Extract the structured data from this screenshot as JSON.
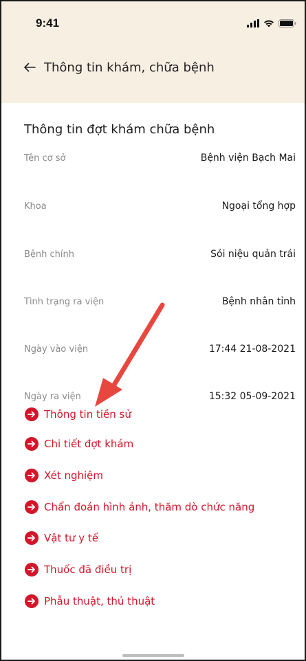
{
  "status_bar": {
    "time": "9:41"
  },
  "nav": {
    "title": "Thông tin khám, chữa bệnh"
  },
  "section": {
    "title": "Thông tin đợt khám chữa bệnh"
  },
  "info_rows": [
    {
      "label": "Tên cơ sở",
      "value": "Bệnh viện Bạch Mai"
    },
    {
      "label": "Khoa",
      "value": "Ngoại tổng hợp"
    },
    {
      "label": "Bệnh chính",
      "value": "Sỏi niệu quản trái"
    },
    {
      "label": "Tình trạng ra viện",
      "value": "Bệnh nhân tỉnh"
    },
    {
      "label": "Ngày vào viện",
      "value": "17:44 21-08-2021"
    },
    {
      "label": "Ngày ra viện",
      "value": "15:32 05-09-2021"
    }
  ],
  "links": [
    {
      "label": "Thông tin tiền sử"
    },
    {
      "label": "Chi tiết đợt khám"
    },
    {
      "label": "Xét nghiệm"
    },
    {
      "label": "Chẩn đoán hình ảnh, thăm dò chức năng"
    },
    {
      "label": "Vật tư y tế"
    },
    {
      "label": "Thuốc đã điều trị"
    },
    {
      "label": "Phẫu thuật, thủ thuật"
    }
  ],
  "colors": {
    "header_bg": "#f8efe3",
    "accent_red": "#d3162a",
    "label_gray": "#8a8a8a",
    "annotation_arrow": "#e8473f"
  },
  "icons": {
    "back": "arrow-left-icon",
    "link": "circle-arrow-right-icon",
    "signal": "cellular-signal-icon",
    "wifi": "wifi-icon",
    "battery": "battery-icon"
  }
}
